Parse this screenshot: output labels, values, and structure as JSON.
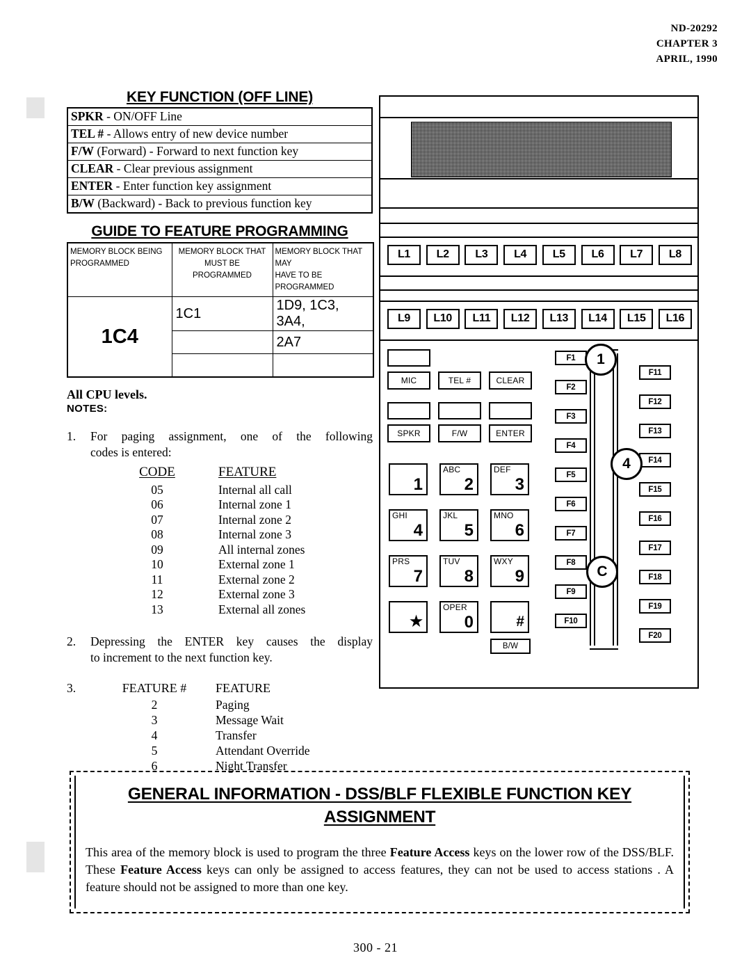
{
  "header": {
    "doc_number": "ND-20292",
    "chapter": "CHAPTER 3",
    "date": "APRIL, 1990"
  },
  "key_function": {
    "title": "KEY FUNCTION (OFF LINE)",
    "rows": [
      {
        "key": "SPKR",
        "desc": " -  ON/OFF Line"
      },
      {
        "key": "TEL #",
        "desc": " - Allows entry of new device number"
      },
      {
        "key": "F/W",
        "desc": " (Forward) - Forward to next function key"
      },
      {
        "key": "CLEAR",
        "desc": " -  Clear previous  assignment"
      },
      {
        "key": "ENTER",
        "desc": " - Enter function key assignment"
      },
      {
        "key": "B/W",
        "desc": " (Backward) - Back to previous function key"
      }
    ]
  },
  "guide": {
    "title": "GUIDE TO FEATURE PROGRAMMING",
    "headers": {
      "col1_line1": "MEMORY BLOCK BEING",
      "col1_line2": "PROGRAMMED",
      "col2_line1": "MEMORY BLOCK THAT",
      "col2_line2": "MUST BE PROGRAMMED",
      "col3_line1": "MEMORY BLOCK THAT MAY",
      "col3_line2": "HAVE TO BE PROGRAMMED"
    },
    "block_being_programmed": "1C4",
    "rows": [
      {
        "must": "1C1",
        "may": "1D9, 1C3, 3A4,"
      },
      {
        "must": "",
        "may": "2A7"
      },
      {
        "must": "",
        "may": ""
      }
    ]
  },
  "cpu_note": "All CPU levels.",
  "notes_label": "NOTES:",
  "notes": {
    "note1": {
      "number": "1.",
      "line1": "For  paging  assignment, one of   the   following",
      "line2": "codes is entered:",
      "code_header": "CODE",
      "feature_header": "FEATURE",
      "rows": [
        {
          "code": "05",
          "feature": "Internal all call"
        },
        {
          "code": "06",
          "feature": "Internal zone 1"
        },
        {
          "code": "07",
          "feature": "Internal zone 2"
        },
        {
          "code": "08",
          "feature": "Internal zone 3"
        },
        {
          "code": "09",
          "feature": "All internal zones"
        },
        {
          "code": "10",
          "feature": "External zone 1"
        },
        {
          "code": "11",
          "feature": "External zone 2"
        },
        {
          "code": "12",
          "feature": "External zone 3"
        },
        {
          "code": "13",
          "feature": "External all zones"
        }
      ]
    },
    "note2": {
      "number": "2.",
      "line1": "Depressing  the  ENTER  key  causes  the  display",
      "line2": "to increment to the next function key."
    },
    "note3": {
      "number": "3.",
      "feature_num_header": "FEATURE #",
      "feature_header": "FEATURE",
      "rows": [
        {
          "num": "2",
          "feature": "Paging"
        },
        {
          "num": "3",
          "feature": "Message Wait"
        },
        {
          "num": "4",
          "feature": "Transfer"
        },
        {
          "num": "5",
          "feature": "Attendant Override"
        },
        {
          "num": "6",
          "feature": "Night Transfer"
        }
      ]
    }
  },
  "phone": {
    "line_keys_row1": [
      "L1",
      "L2",
      "L3",
      "L4",
      "L5",
      "L6",
      "L7",
      "L8"
    ],
    "line_keys_row2": [
      "L9",
      "L10",
      "L11",
      "L12",
      "L13",
      "L14",
      "L15",
      "L16"
    ],
    "function_labels": {
      "mic": "MIC",
      "tel": "TEL #",
      "clear": "CLEAR",
      "spkr": "SPKR",
      "fw": "F/W",
      "enter": "ENTER",
      "bw": "B/W"
    },
    "dialpad": [
      {
        "alpha": "",
        "digit": "1"
      },
      {
        "alpha": "ABC",
        "digit": "2"
      },
      {
        "alpha": "DEF",
        "digit": "3"
      },
      {
        "alpha": "GHI",
        "digit": "4"
      },
      {
        "alpha": "JKL",
        "digit": "5"
      },
      {
        "alpha": "MNO",
        "digit": "6"
      },
      {
        "alpha": "PRS",
        "digit": "7"
      },
      {
        "alpha": "TUV",
        "digit": "8"
      },
      {
        "alpha": "WXY",
        "digit": "9"
      },
      {
        "alpha": "",
        "digit": "★"
      },
      {
        "alpha": "OPER",
        "digit": "0"
      },
      {
        "alpha": "",
        "digit": "#"
      }
    ],
    "f_keys_left": [
      "F1",
      "F2",
      "F3",
      "F4",
      "F5",
      "F6",
      "F7",
      "F8",
      "F9",
      "F10"
    ],
    "f_keys_right": [
      "F11",
      "F12",
      "F13",
      "F14",
      "F15",
      "F16",
      "F17",
      "F18",
      "F19",
      "F20"
    ],
    "callouts": {
      "one": "1",
      "four": "4",
      "c": "C"
    }
  },
  "general_info": {
    "title_line1": "GENERAL INFORMATION - DSS/BLF FLEXIBLE FUNCTION KEY",
    "title_line2": "ASSIGNMENT",
    "body_part1": "This area of the memory block is used to program the three ",
    "body_bold1": "Feature Access",
    "body_part2": " keys on the lower row of the DSS/BLF.   These ",
    "body_bold2": "Feature Access",
    "body_part3": " keys can only be assigned to access  features, they can not be used to access stations .  A feature should not be assigned to more than one key."
  },
  "footer": {
    "page": "300 - 21"
  }
}
